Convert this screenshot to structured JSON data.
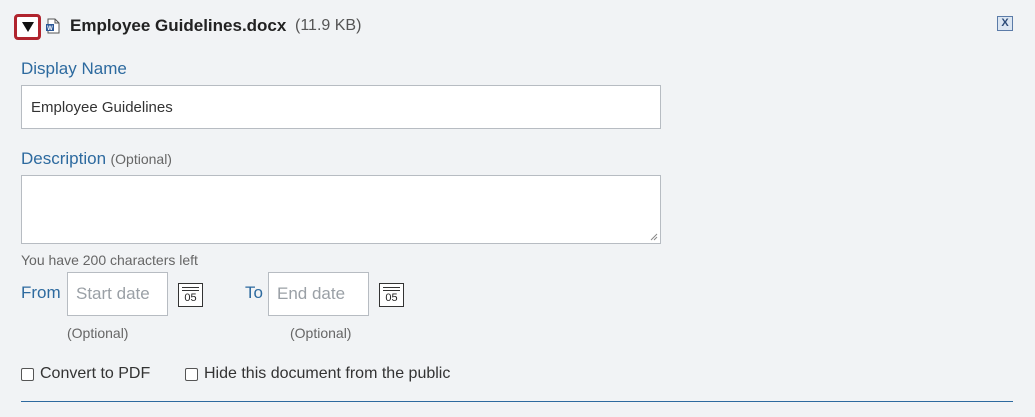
{
  "file": {
    "name": "Employee Guidelines.docx",
    "size": "(11.9 KB)",
    "icon": "word-document-icon",
    "close_label": "X"
  },
  "display_name": {
    "label": "Display Name",
    "value": "Employee Guidelines"
  },
  "description": {
    "label": "Description",
    "optional": "(Optional)",
    "value": "",
    "chars_left": "You have 200 characters left"
  },
  "dates": {
    "from_label": "From",
    "to_label": "To",
    "start_placeholder": "Start date",
    "end_placeholder": "End date",
    "calendar_day": "05",
    "start_optional": "(Optional)",
    "end_optional": "(Optional)"
  },
  "options": {
    "convert_pdf": "Convert to PDF",
    "hide_public": "Hide this document from the public"
  },
  "colors": {
    "accent": "#2d6a9f",
    "toggle_border": "#b0242e",
    "background": "#f1f3f5"
  }
}
